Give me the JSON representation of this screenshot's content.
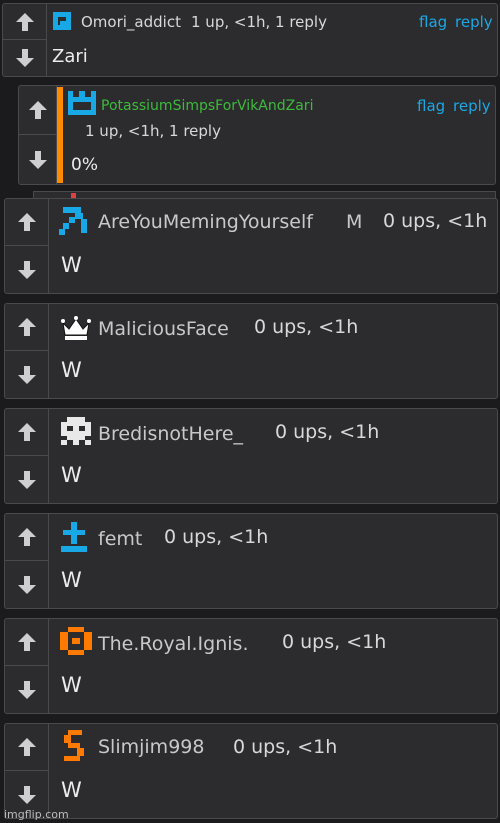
{
  "comments": [
    {
      "username": "Omori_addict",
      "meta": "1 up, <1h, 1 reply",
      "text": "Zari",
      "flag": "flag",
      "reply": "reply",
      "icon": "blue-square-icon",
      "username_color": "#d8d8d8"
    },
    {
      "username": "PotassiumSimpsForVikAndZari",
      "meta": "1 up, <1h, 1 reply",
      "text": "0%",
      "flag": "flag",
      "reply": "reply",
      "icon": "blue-crown-icon",
      "username_color": "#3cbb3c",
      "accent_color": "#ff8c00"
    },
    {
      "username": "AreYouMemingYourself",
      "badge": "M",
      "meta": "0 ups, <1h",
      "text": "W",
      "icon": "blue-pickaxe-icon"
    },
    {
      "username": "MaliciousFace",
      "meta": "0 ups, <1h",
      "text": "W",
      "icon": "crown-icon"
    },
    {
      "username": "BredisnotHere_",
      "meta": "0 ups, <1h",
      "text": "W",
      "icon": "skull-icon"
    },
    {
      "username": "femt",
      "meta": "0 ups, <1h",
      "text": "W",
      "icon": "blue-cross-icon"
    },
    {
      "username": "The.Royal.Ignis.",
      "meta": "0 ups, <1h",
      "text": "W",
      "icon": "orange-ring-icon"
    },
    {
      "username": "Slimjim998",
      "meta": "0 ups, <1h",
      "text": "W",
      "icon": "orange-snake-icon"
    }
  ],
  "watermark": "imgflip.com"
}
